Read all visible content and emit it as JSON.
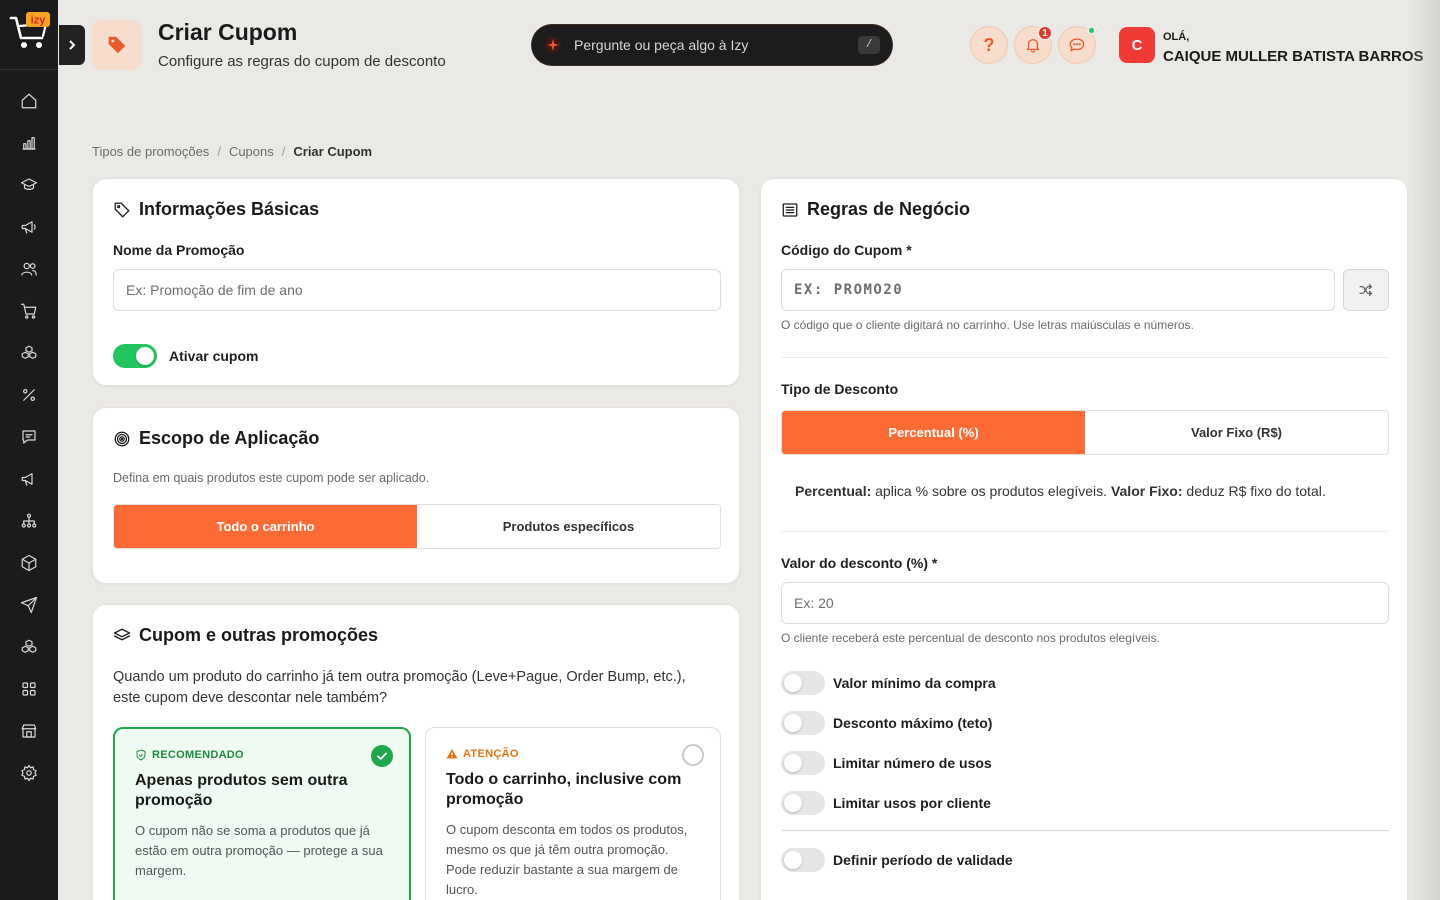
{
  "header": {
    "title": "Criar Cupom",
    "subtitle": "Configure as regras do cupom de desconto",
    "ask_placeholder": "Pergunte ou peça algo à Izy",
    "ask_shortcut": "/",
    "help_label": "?",
    "notification_count": "1",
    "greeting": "OLÁ,",
    "user_name": "CAIQUE MULLER BATISTA BARROS",
    "avatar_initial": "C"
  },
  "logo_text": "izy",
  "sidebar": {
    "items": [
      {
        "icon": "home-icon"
      },
      {
        "icon": "bar-chart-icon"
      },
      {
        "icon": "graduation-cap-icon"
      },
      {
        "icon": "megaphone-icon"
      },
      {
        "icon": "users-icon"
      },
      {
        "icon": "shopping-cart-icon"
      },
      {
        "icon": "boxes-icon"
      },
      {
        "icon": "percent-icon"
      },
      {
        "icon": "message-icon"
      },
      {
        "icon": "megaphone-icon"
      },
      {
        "icon": "network-icon"
      },
      {
        "icon": "package-icon"
      },
      {
        "icon": "send-icon"
      },
      {
        "icon": "boxes-icon"
      },
      {
        "icon": "grid-icon"
      },
      {
        "icon": "store-icon"
      },
      {
        "icon": "settings-icon"
      }
    ]
  },
  "breadcrumb": {
    "items": [
      "Tipos de promoções",
      "Cupons"
    ],
    "separator": "/",
    "current": "Criar Cupom"
  },
  "basic_info": {
    "title": "Informações Básicas",
    "name_label": "Nome da Promoção",
    "name_placeholder": "Ex: Promoção de fim de ano",
    "name_value": "",
    "activate_label": "Ativar cupom",
    "activate_on": true
  },
  "scope": {
    "title": "Escopo de Aplicação",
    "description": "Defina em quais produtos este cupom pode ser aplicado.",
    "options": [
      "Todo o carrinho",
      "Produtos específicos"
    ],
    "selected": "Todo o carrinho"
  },
  "stacking": {
    "title": "Cupom e outras promoções",
    "question": "Quando um produto do carrinho já tem outra promoção (Leve+Pague, Order Bump, etc.), este cupom deve descontar nele também?",
    "recommended": {
      "tag": "RECOMENDADO",
      "title": "Apenas produtos sem outra promoção",
      "description": "O cupom não se soma a produtos que já estão em outra promoção — protege a sua margem.",
      "selected": true
    },
    "warning": {
      "tag": "ATENÇÃO",
      "title": "Todo o carrinho, inclusive com promoção",
      "description": "O cupom desconta em todos os produtos, mesmo os que já têm outra promoção. Pode reduzir bastante a sua margem de lucro.",
      "selected": false
    }
  },
  "rules": {
    "title": "Regras de Negócio",
    "code_label": "Código do Cupom *",
    "code_placeholder": "EX: PROMO20",
    "code_value": "",
    "code_hint": "O código que o cliente digitará no carrinho. Use letras maiúsculas e números.",
    "discount_type_label": "Tipo de Desconto",
    "discount_types": [
      "Percentual (%)",
      "Valor Fixo (R$)"
    ],
    "discount_type_selected": "Percentual (%)",
    "explain_percent_label": "Percentual:",
    "explain_percent_text": " aplica % sobre os produtos elegíveis. ",
    "explain_fixed_label": "Valor Fixo:",
    "explain_fixed_text": " deduz R$ fixo do total.",
    "value_label": "Valor do desconto (%) *",
    "value_placeholder": "Ex: 20",
    "value_value": "",
    "value_hint": "O cliente receberá este percentual de desconto nos produtos elegíveis.",
    "toggles": [
      {
        "label": "Valor mínimo da compra",
        "on": false
      },
      {
        "label": "Desconto máximo (teto)",
        "on": false
      },
      {
        "label": "Limitar número de usos",
        "on": false
      },
      {
        "label": "Limitar usos por cliente",
        "on": false
      }
    ],
    "validity_label": "Definir período de validade",
    "validity_on": false
  },
  "colors": {
    "accent": "#fd6b35",
    "success": "#1fa64a",
    "toggle_on": "#22c55e",
    "warning": "#e8730c",
    "sidebar_bg": "#1b1b1b",
    "page_bg": "#ebe9e6"
  }
}
